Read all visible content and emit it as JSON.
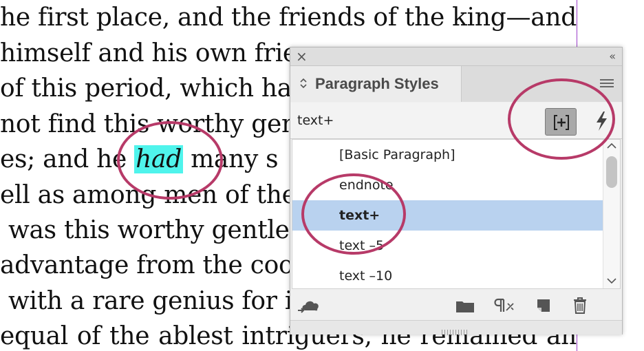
{
  "document": {
    "lines": [
      "he first place, and the friends of the king—and",
      "himself and his own frie",
      "of this period, which has",
      "not find this worthy gen",
      "es; and he",
      "ell as among men of the",
      "was this worthy gentler",
      "advantage from the coop",
      "with a rare genius for i",
      "equal of the ablest intriguers, he remained an"
    ],
    "highlighted_word": "had",
    "line5_after": " many s"
  },
  "panel": {
    "close_label": "×",
    "collapse_label": "‹‹",
    "tab_title": "Paragraph Styles",
    "current_style": "text+",
    "styles": [
      {
        "label": "[Basic Paragraph]"
      },
      {
        "label": "endnote"
      },
      {
        "label": "text+"
      },
      {
        "label": "text –5"
      },
      {
        "label": "text –10"
      }
    ],
    "selected_index": 2
  },
  "colors": {
    "highlight": "#4ff4ec",
    "selection": "#b9d2ef",
    "annotation": "#b73a68",
    "margin_guide": "#9a3cc9"
  },
  "icons": {
    "panel_menu": "hamburger-icon",
    "new_style_override": "new-style-override-icon",
    "quick_apply": "lightning-bolt-icon",
    "cc_libraries": "cloud-libraries-icon",
    "new_group": "folder-icon",
    "clear_overrides": "clear-overrides-icon",
    "new_style": "new-page-icon",
    "delete": "trash-icon"
  }
}
